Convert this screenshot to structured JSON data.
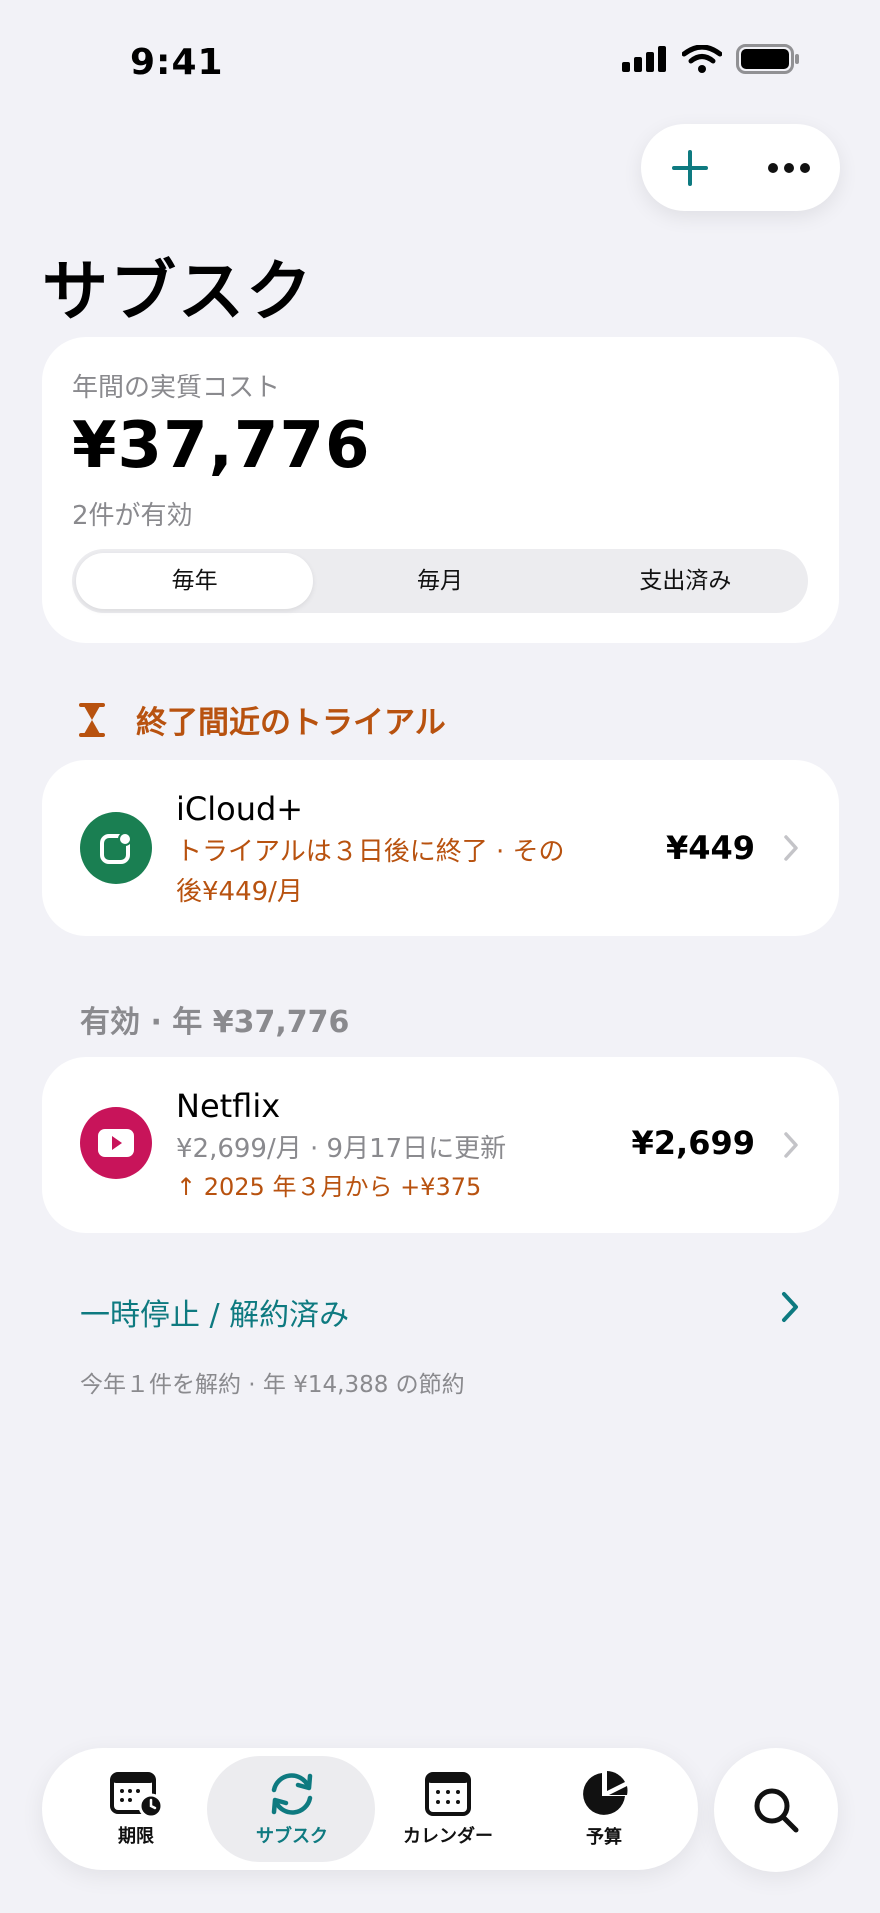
{
  "status_bar": {
    "time": "9:41"
  },
  "page": {
    "title": "サブスク"
  },
  "summary": {
    "label": "年間の実質コスト",
    "value": "¥37,776",
    "sub": "2件が有効",
    "segments": [
      "毎年",
      "毎月",
      "支出済み"
    ],
    "selected_segment": "毎年"
  },
  "trial_section": {
    "title": "終了間近のトライアル",
    "items": [
      {
        "name": "iCloud+",
        "line1": "トライアルは３日後に終了 · その",
        "line2": "後¥449/月",
        "price": "¥449",
        "icon_color": "#1a7f52"
      }
    ]
  },
  "active_section": {
    "title": "有効 · 年 ¥37,776",
    "items": [
      {
        "name": "Netflix",
        "line1": "¥2,699/月 · 9月17日に更新",
        "line2": "↑ 2025 年３月から +¥375",
        "price": "¥2,699",
        "icon_color": "#c8145a"
      }
    ]
  },
  "paused": {
    "label": "一時停止 / 解約済み",
    "note": "今年１件を解約 · 年 ¥14,388 の節約"
  },
  "tabbar": {
    "tabs": [
      {
        "label": "期限",
        "icon": "calendar-clock-icon"
      },
      {
        "label": "サブスク",
        "icon": "sync-icon"
      },
      {
        "label": "カレンダー",
        "icon": "calendar-icon"
      },
      {
        "label": "予算",
        "icon": "pie-chart-icon"
      }
    ],
    "active": "サブスク"
  },
  "colors": {
    "accent": "#0e7a80",
    "warning": "#b8520f",
    "muted": "#8a8a8e"
  }
}
